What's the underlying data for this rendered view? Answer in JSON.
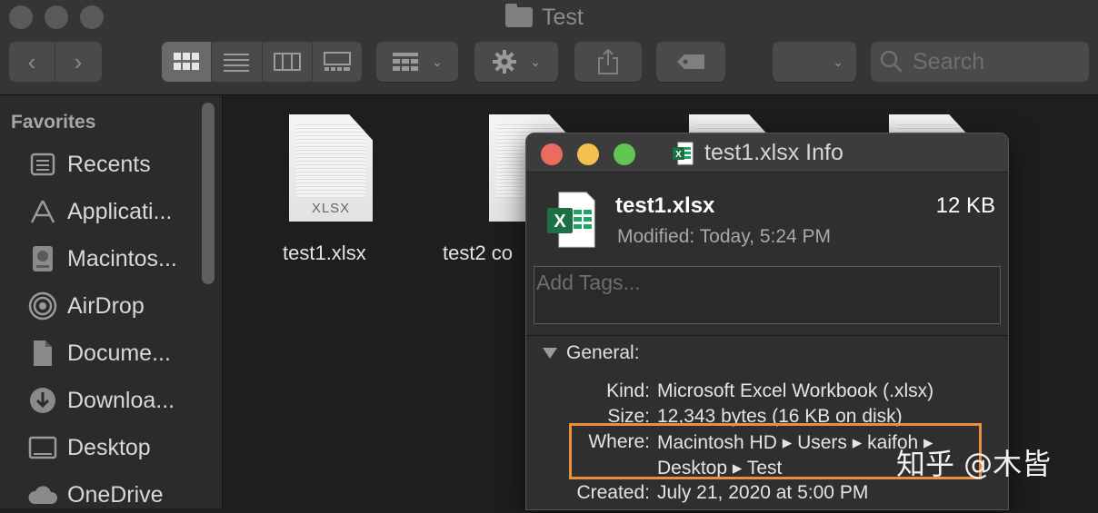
{
  "window": {
    "title": "Test"
  },
  "toolbar": {
    "search_placeholder": "Search"
  },
  "sidebar": {
    "heading": "Favorites",
    "items": [
      {
        "label": "Recents",
        "icon": "clock-icon"
      },
      {
        "label": "Applicati...",
        "icon": "applications-icon"
      },
      {
        "label": "Macintos...",
        "icon": "hard-drive-icon"
      },
      {
        "label": "AirDrop",
        "icon": "airdrop-icon"
      },
      {
        "label": "Docume...",
        "icon": "document-icon"
      },
      {
        "label": "Downloa...",
        "icon": "download-icon"
      },
      {
        "label": "Desktop",
        "icon": "desktop-icon"
      },
      {
        "label": "OneDrive",
        "icon": "cloud-icon"
      }
    ]
  },
  "files": [
    {
      "name": "test1.xlsx",
      "ext": "XLSX"
    },
    {
      "name": "test2 co",
      "ext": "XL"
    }
  ],
  "info": {
    "window_title": "test1.xlsx Info",
    "filename": "test1.xlsx",
    "size": "12 KB",
    "modified": "Modified: Today, 5:24 PM",
    "tags_placeholder": "Add Tags...",
    "section": "General:",
    "kind_label": "Kind:",
    "kind": "Microsoft Excel Workbook (.xlsx)",
    "size_label": "Size:",
    "size_detail": "12,343 bytes (16 KB on disk)",
    "where_label": "Where:",
    "where_line1": "Macintosh HD ▸ Users ▸ kaifoh ▸",
    "where_line2": "Desktop ▸ Test",
    "created_label": "Created:",
    "created": "July 21, 2020 at 5:00 PM"
  },
  "watermark": "知乎 @木皆",
  "colors": {
    "highlight": "#e9903a",
    "excel_green": "#1d7044"
  }
}
